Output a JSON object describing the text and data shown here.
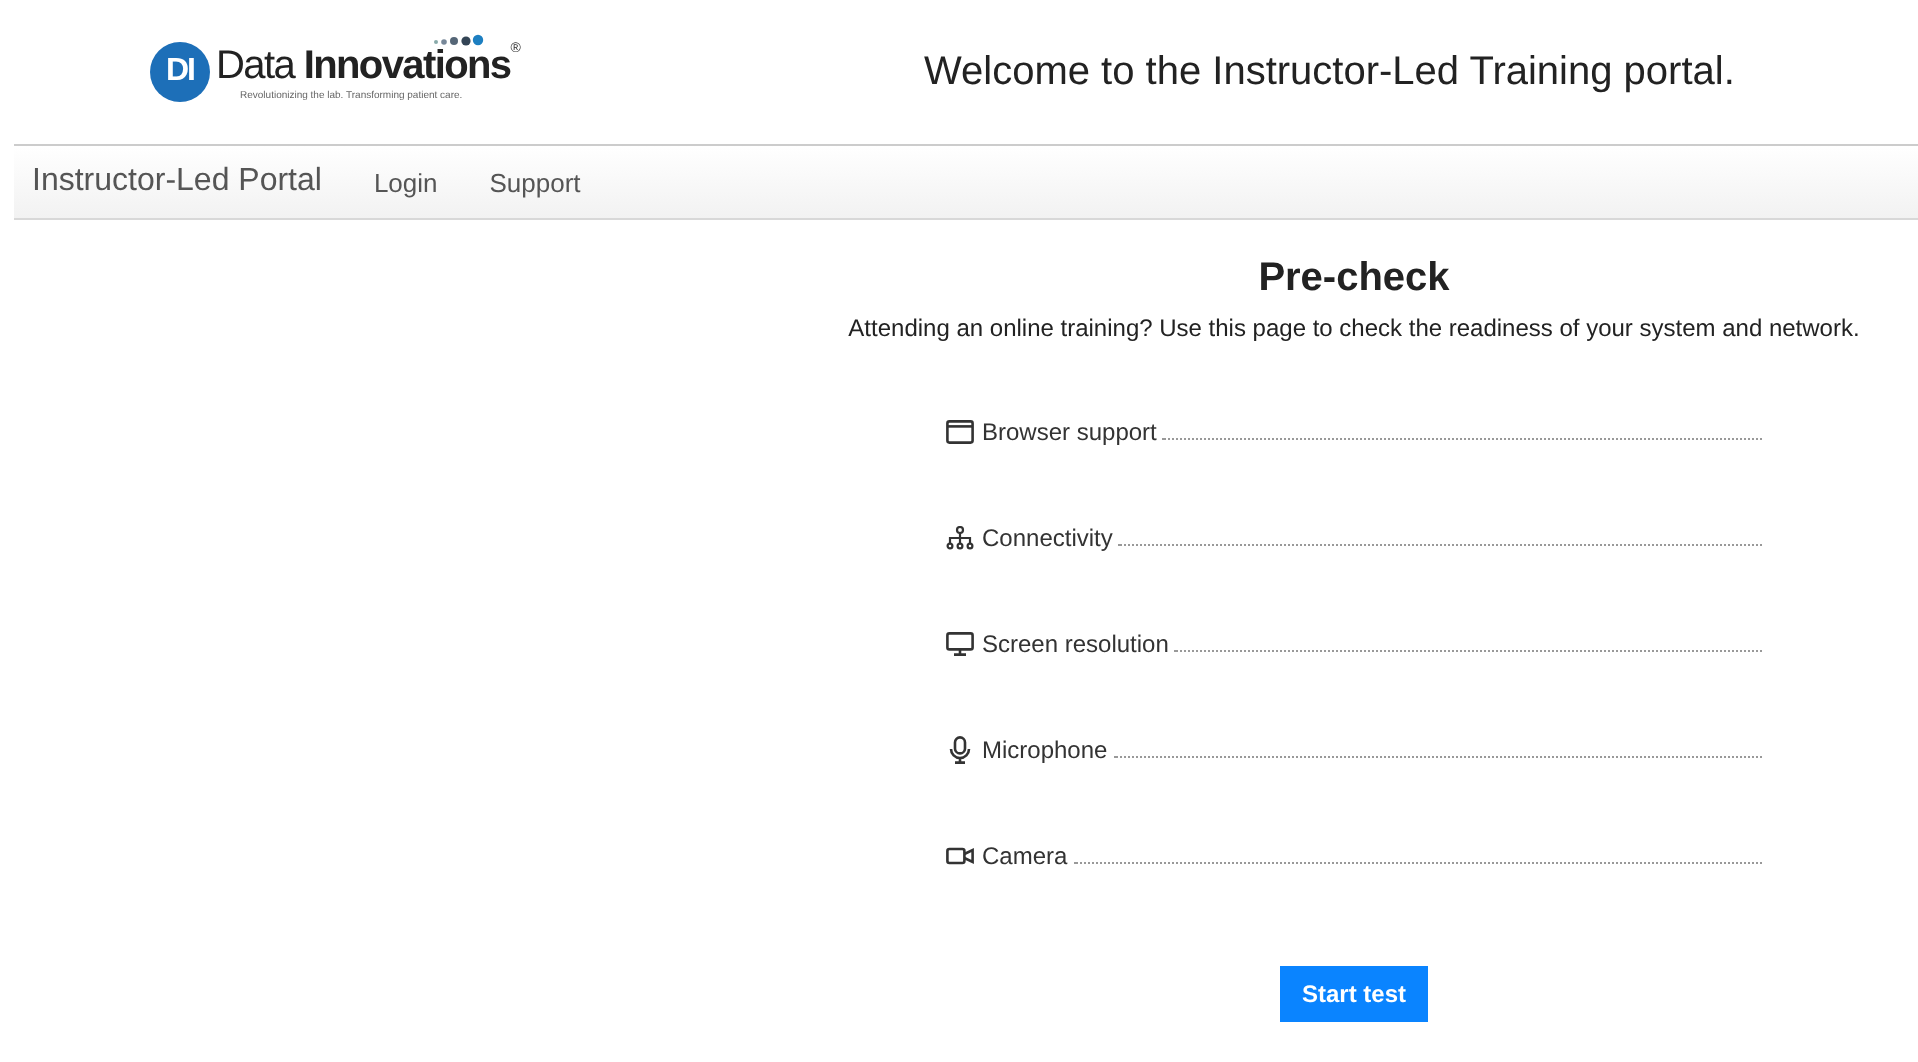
{
  "header": {
    "logo": {
      "mark": "DI",
      "name_light": "Data",
      "name_bold": "Innovations",
      "trademark": "®",
      "tagline": "Revolutionizing the lab. Transforming patient care."
    },
    "welcome": "Welcome to the Instructor-Led Training portal."
  },
  "navbar": {
    "brand": "Instructor-Led Portal",
    "links": [
      "Login",
      "Support"
    ]
  },
  "precheck": {
    "title": "Pre-check",
    "subtitle": "Attending an online training? Use this page to check the readiness of your system and network.",
    "items": [
      {
        "kind": "browser",
        "label": "Browser support"
      },
      {
        "kind": "network",
        "label": "Connectivity"
      },
      {
        "kind": "monitor",
        "label": "Screen resolution"
      },
      {
        "kind": "mic",
        "label": "Microphone"
      },
      {
        "kind": "camera",
        "label": "Camera"
      }
    ],
    "button": "Start test"
  }
}
